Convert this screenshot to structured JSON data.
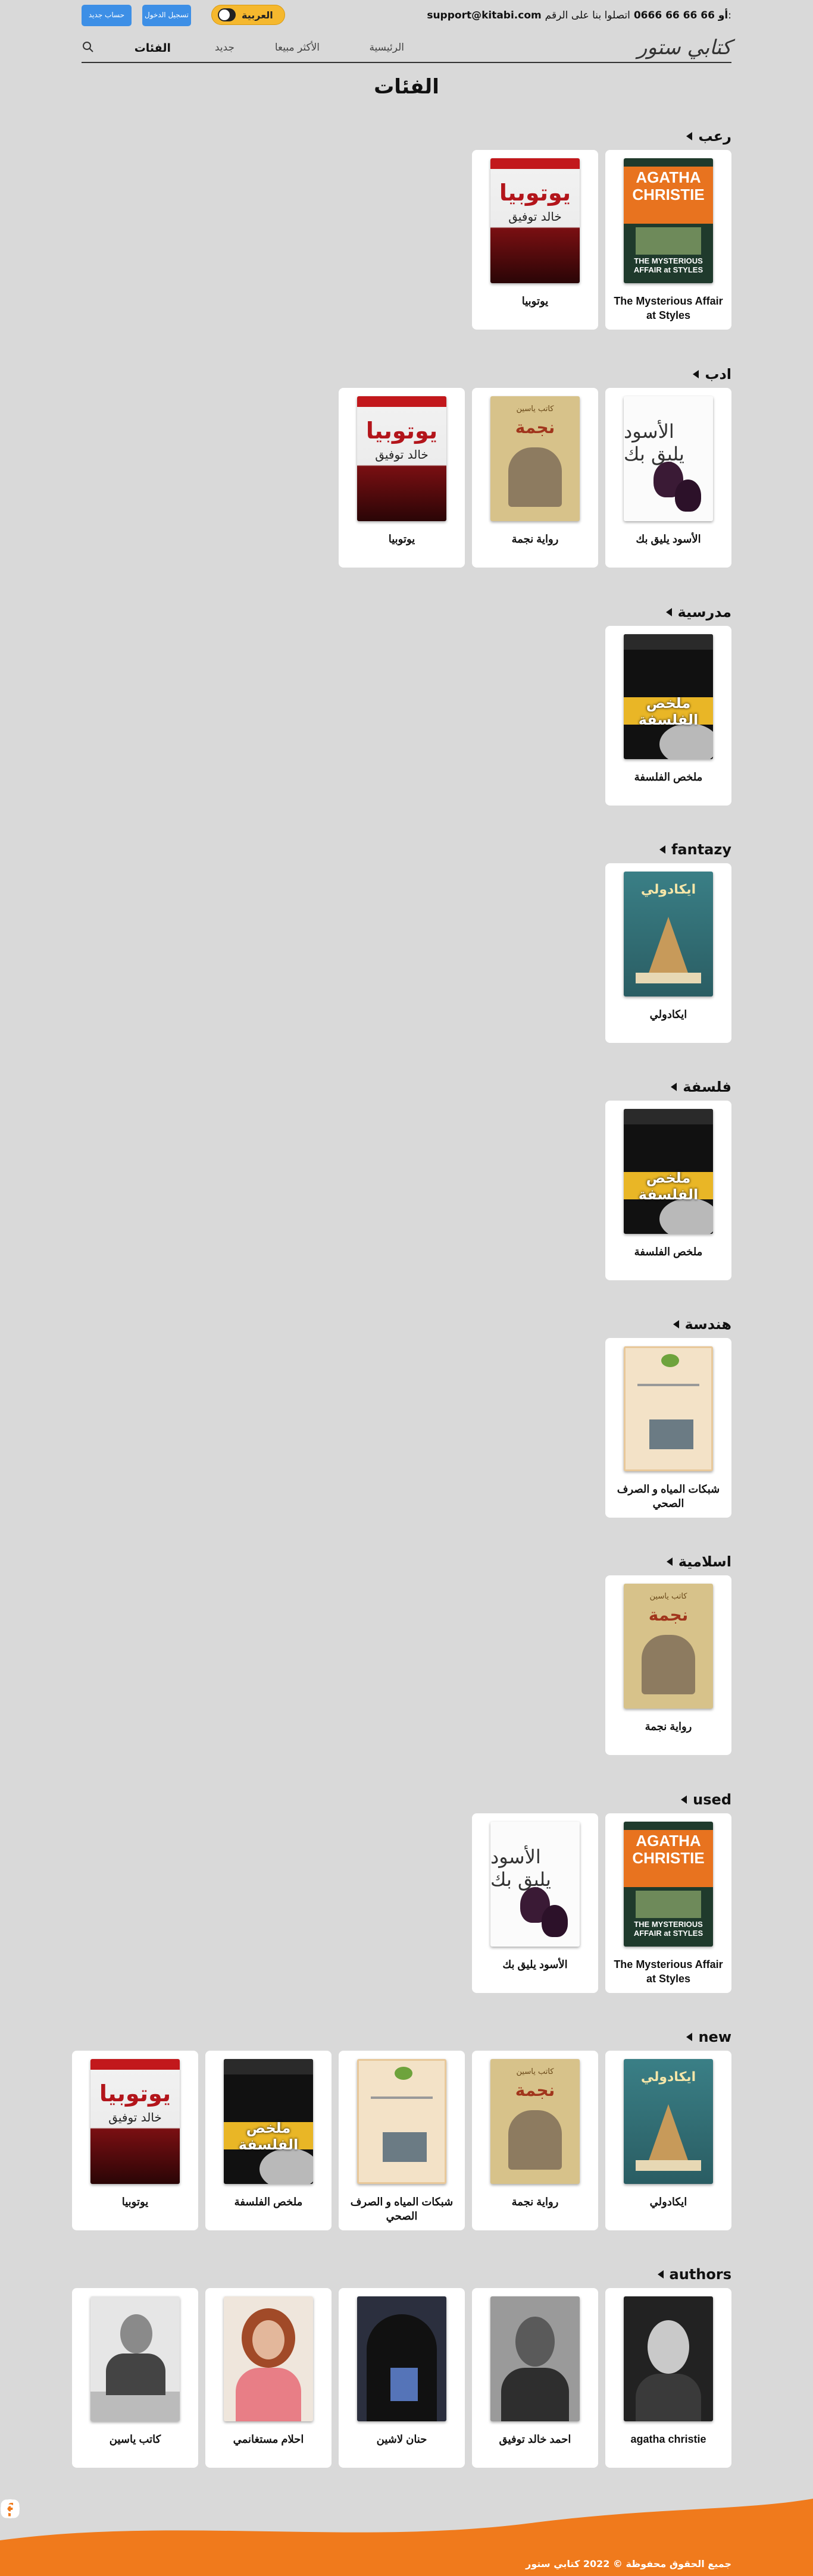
{
  "topbar": {
    "contact_label": "اتصلوا بنا على الرقم:",
    "contact_phone": "66 66 66 0666",
    "contact_sep": "أو",
    "contact_email": "support@kitabi.com",
    "language": "العربية",
    "login_label": "تسجيل الدخول",
    "signup_label": "حساب جديد"
  },
  "nav": {
    "logo": "كتابي ستور",
    "links": [
      "الرئيسية",
      "الأكثر مبيعا",
      "جديد",
      "الفئات"
    ],
    "active_index": 3
  },
  "page_title": "الفئات",
  "sections": [
    {
      "title": "رعب",
      "items": [
        "The Mysterious Affair at Styles",
        "يوتوبيا"
      ]
    },
    {
      "title": "ادب",
      "items": [
        "الأسود يليق بك",
        "رواية نجمة",
        "يوتوبيا"
      ]
    },
    {
      "title": "مدرسية",
      "items": [
        "ملخص الفلسفة"
      ]
    },
    {
      "title": "fantazy",
      "items": [
        "ايكادولي"
      ]
    },
    {
      "title": "فلسفة",
      "items": [
        "ملخص الفلسفة"
      ]
    },
    {
      "title": "هندسة",
      "items": [
        "شبكات المياه و الصرف الصحي"
      ]
    },
    {
      "title": "اسلامية",
      "items": [
        "رواية نجمة"
      ]
    },
    {
      "title": "used",
      "items": [
        "The Mysterious Affair at Styles",
        "الأسود يليق بك"
      ]
    },
    {
      "title": "new",
      "items": [
        "ايكادولي",
        "رواية نجمة",
        "شبكات المياه و الصرف الصحي",
        "ملخص الفلسفة",
        "يوتوبيا"
      ]
    },
    {
      "title": "authors",
      "items": [
        "agatha christie",
        "احمد خالد توفيق",
        "حنان لاشين",
        "احلام مستغانمي",
        "كاتب ياسين"
      ]
    }
  ],
  "covers": {
    "agatha_title": "AGATHA CHRISTIE",
    "agatha_sub": "THE MYSTERIOUS AFFAIR at STYLES",
    "utopia_title": "يوتوبيا",
    "utopia_author": "خالد توفيق",
    "najma_author": "كاتب ياسين",
    "najma_title": "نجمة",
    "aswad_title": "الأسود يليق بك",
    "philo_title": "ملخص الفلسفة",
    "ekadoli_title": "ايكادولي"
  },
  "footer": {
    "copyright": "جميع الحقوق محفوظة © 2022 كتابي ستور",
    "color": "#f07a1c"
  },
  "colors": {
    "background": "#d9d9d9",
    "accent_orange": "#f07a1c",
    "button_blue": "#3d8fe6",
    "toggle_yellow": "#f5b82e"
  }
}
